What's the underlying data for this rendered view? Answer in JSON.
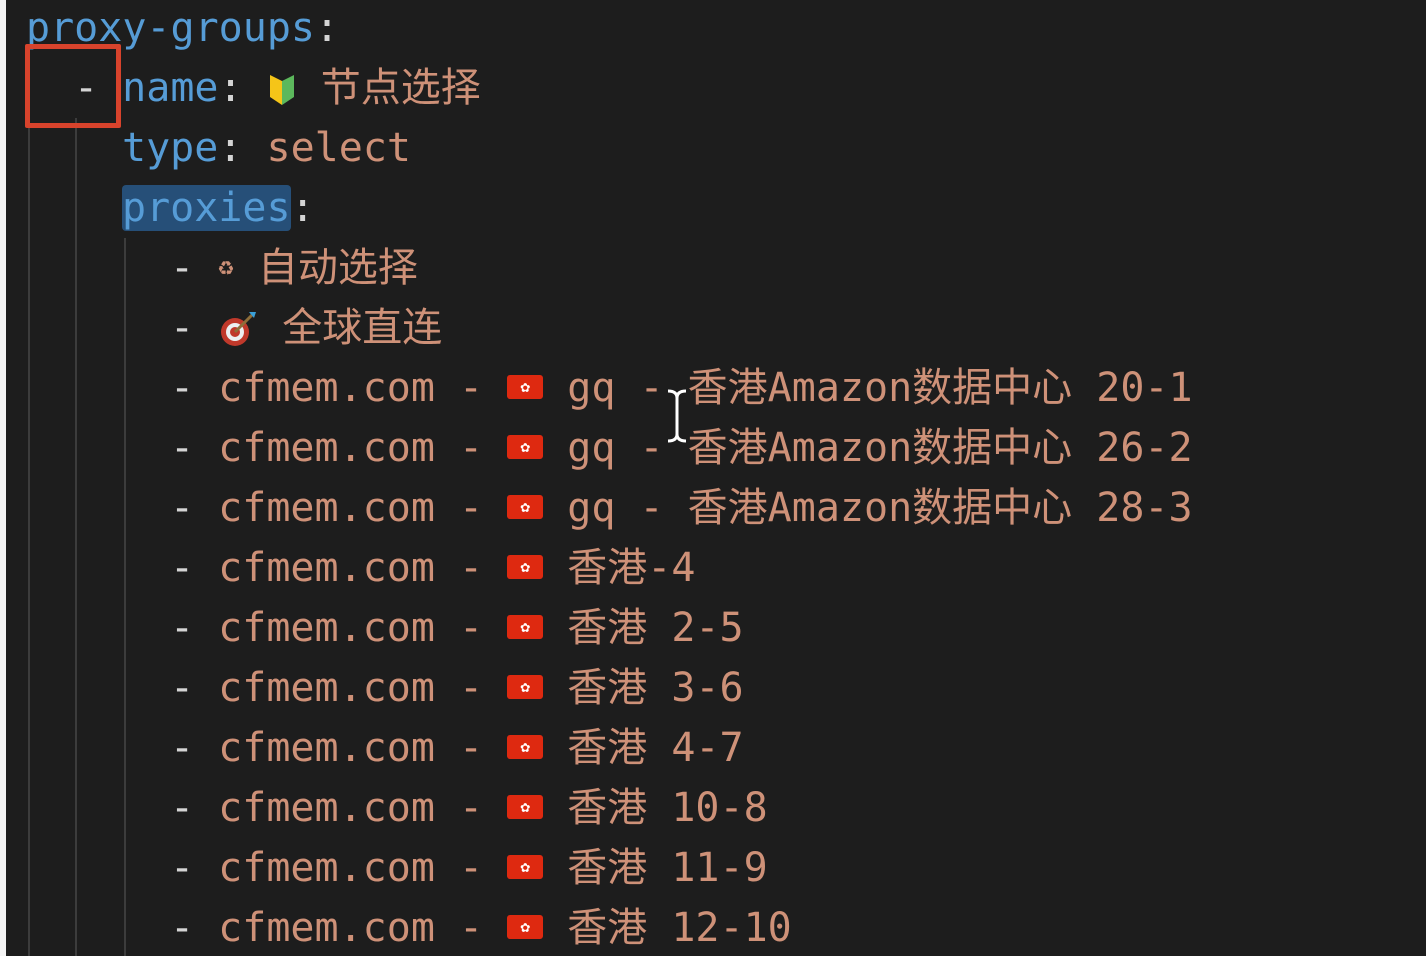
{
  "root_key": "proxy-groups",
  "group": {
    "name_key": "name",
    "name_icon": "beginner-shield-icon",
    "name_value": "节点选择",
    "type_key": "type",
    "type_value": "select",
    "proxies_key": "proxies"
  },
  "colors": {
    "background": "#1d1d1d",
    "key": "#569cd6",
    "string": "#ce9178",
    "selection": "#264f78",
    "highlight_box": "#d8432c"
  },
  "proxies": [
    {
      "icon": "recycle-icon",
      "text": "自动选择"
    },
    {
      "icon": "target-icon",
      "text": "全球直连"
    },
    {
      "prefix": "cfmem.com - ",
      "icon": "hk-flag-icon",
      "text": "gq - 香港Amazon数据中心 20-1"
    },
    {
      "prefix": "cfmem.com - ",
      "icon": "hk-flag-icon",
      "text": "gq - 香港Amazon数据中心 26-2"
    },
    {
      "prefix": "cfmem.com - ",
      "icon": "hk-flag-icon",
      "text": "gq - 香港Amazon数据中心 28-3"
    },
    {
      "prefix": "cfmem.com - ",
      "icon": "hk-flag-icon",
      "text": "香港-4"
    },
    {
      "prefix": "cfmem.com - ",
      "icon": "hk-flag-icon",
      "text": "香港 2-5"
    },
    {
      "prefix": "cfmem.com - ",
      "icon": "hk-flag-icon",
      "text": "香港 3-6"
    },
    {
      "prefix": "cfmem.com - ",
      "icon": "hk-flag-icon",
      "text": "香港 4-7"
    },
    {
      "prefix": "cfmem.com - ",
      "icon": "hk-flag-icon",
      "text": "香港 10-8"
    },
    {
      "prefix": "cfmem.com - ",
      "icon": "hk-flag-icon",
      "text": "香港 11-9"
    },
    {
      "prefix": "cfmem.com - ",
      "icon": "hk-flag-icon",
      "text": "香港 12-10"
    }
  ]
}
